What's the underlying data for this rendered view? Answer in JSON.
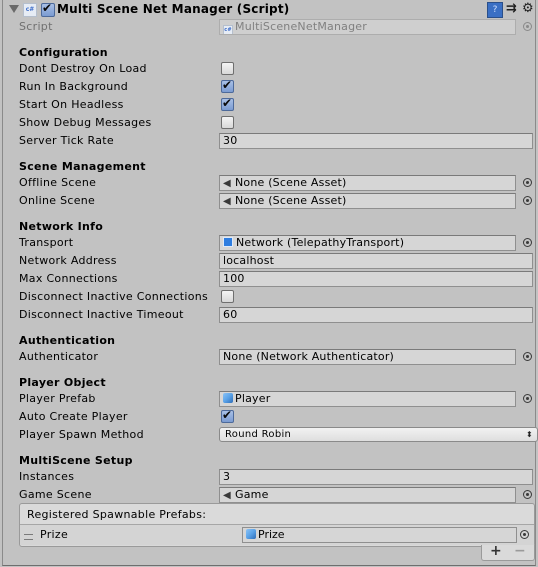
{
  "header": {
    "title": "Multi Scene Net Manager (Script)",
    "enabled": true,
    "script_icon": "cs-script-icon",
    "buttons": [
      "help-icon",
      "preset-icon",
      "gear-icon"
    ]
  },
  "script": {
    "label": "Script",
    "value": "MultiSceneNetManager"
  },
  "sections": {
    "configuration": "Configuration",
    "scene_management": "Scene Management",
    "network_info": "Network Info",
    "authentication": "Authentication",
    "player_object": "Player Object",
    "multiscene_setup": "MultiScene Setup"
  },
  "configuration": {
    "dont_destroy": {
      "label": "Dont Destroy On Load",
      "checked": false
    },
    "run_in_background": {
      "label": "Run In Background",
      "checked": true
    },
    "start_on_headless": {
      "label": "Start On Headless",
      "checked": true
    },
    "show_debug": {
      "label": "Show Debug Messages",
      "checked": false
    },
    "server_tick_rate": {
      "label": "Server Tick Rate",
      "value": "30"
    }
  },
  "scene_management": {
    "offline_scene": {
      "label": "Offline Scene",
      "value": "None (Scene Asset)"
    },
    "online_scene": {
      "label": "Online Scene",
      "value": "None (Scene Asset)"
    }
  },
  "network_info": {
    "transport": {
      "label": "Transport",
      "value": "Network (TelepathyTransport)"
    },
    "network_address": {
      "label": "Network Address",
      "value": "localhost"
    },
    "max_connections": {
      "label": "Max Connections",
      "value": "100"
    },
    "disconnect_inactive": {
      "label": "Disconnect Inactive Connections",
      "checked": false
    },
    "disconnect_timeout": {
      "label": "Disconnect Inactive Timeout",
      "value": "60"
    }
  },
  "authentication": {
    "authenticator": {
      "label": "Authenticator",
      "value": "None (Network Authenticator)"
    }
  },
  "player_object": {
    "player_prefab": {
      "label": "Player Prefab",
      "value": "Player"
    },
    "auto_create": {
      "label": "Auto Create Player",
      "checked": true
    },
    "spawn_method": {
      "label": "Player Spawn Method",
      "value": "Round Robin"
    }
  },
  "multiscene_setup": {
    "instances": {
      "label": "Instances",
      "value": "3"
    },
    "game_scene": {
      "label": "Game Scene",
      "value": "Game"
    }
  },
  "spawnable_prefabs": {
    "header": "Registered Spawnable Prefabs:",
    "items": [
      {
        "label": "Prize",
        "value": "Prize"
      }
    ],
    "add_label": "+",
    "remove_label": "−"
  },
  "icons": {
    "foldout": "▼",
    "cs": "c#",
    "help": "?",
    "preset": "⇉",
    "gear": "⚙",
    "scene": "◀",
    "dropdown": "⬍"
  }
}
